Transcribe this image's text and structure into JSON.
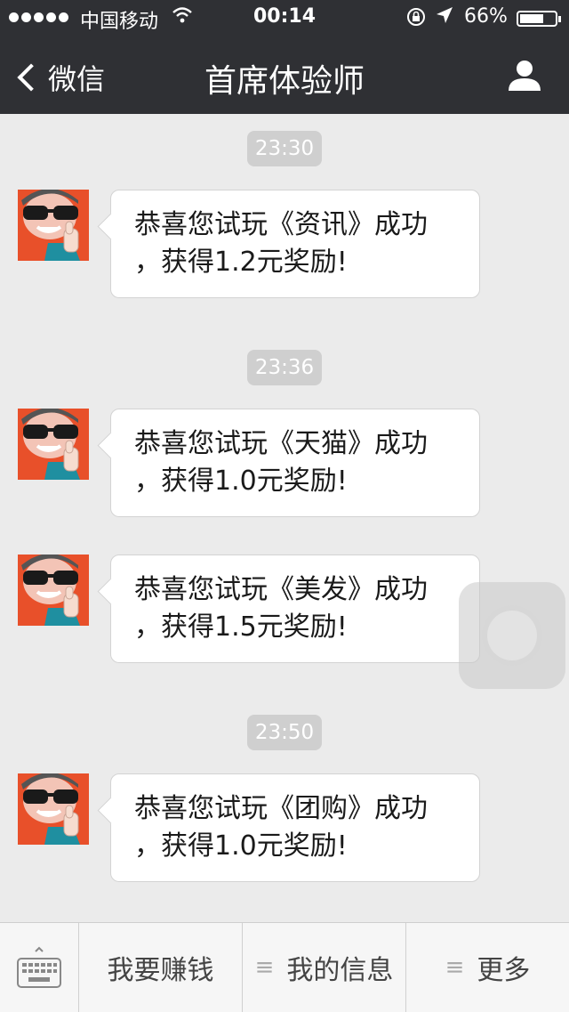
{
  "status_bar": {
    "carrier": "中国移动",
    "time": "00:14",
    "battery": "66%"
  },
  "nav": {
    "back_label": "微信",
    "title": "首席体验师"
  },
  "messages": [
    {
      "time": "23:30",
      "line1": "恭喜您试玩《资讯》成功",
      "line2": "，获得1.2元奖励!"
    },
    {
      "time": "23:36",
      "line1": "恭喜您试玩《天猫》成功",
      "line2": "，获得1.0元奖励!"
    },
    {
      "time": "",
      "line1": "恭喜您试玩《美发》成功",
      "line2": "，获得1.5元奖励!"
    },
    {
      "time": "23:50",
      "line1": "恭喜您试玩《团购》成功",
      "line2": "，获得1.0元奖励!"
    }
  ],
  "menu": [
    {
      "label": "我要赚钱"
    },
    {
      "label": "我的信息"
    },
    {
      "label": "更多"
    }
  ],
  "colors": {
    "navbar": "#2f3034",
    "chat_bg": "#ebebeb",
    "avatar_bg": "#e8502a"
  }
}
